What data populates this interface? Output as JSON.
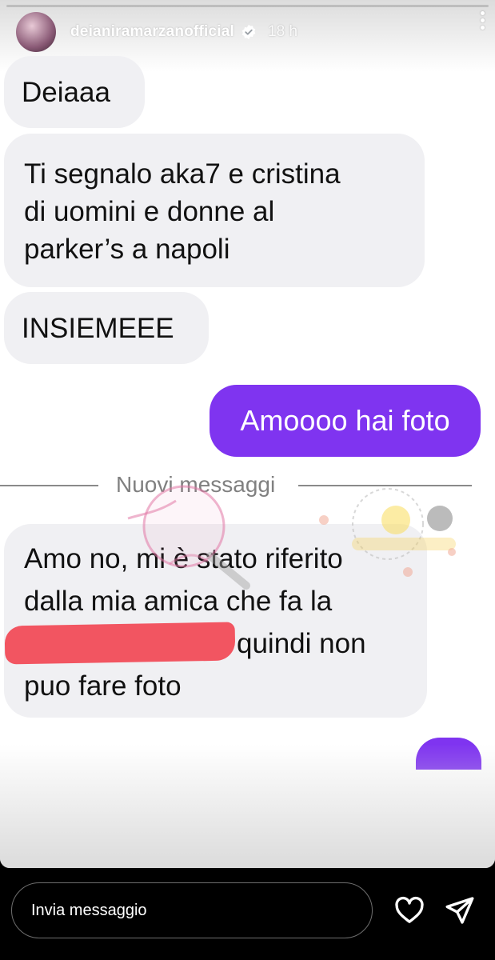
{
  "story": {
    "username": "deianiramarzanofficial",
    "time": "18 h",
    "verified": true
  },
  "chat": {
    "incoming_1": "Deiaaa",
    "incoming_2_lines": [
      "Ti segnalo aka7 e cristina",
      "di uomini e donne al",
      "parker’s a napoli"
    ],
    "incoming_3": "INSIEMEEE",
    "outgoing_1": "Amoooo hai foto",
    "separator": "Nuovi messaggi",
    "incoming_4_lines": [
      "Amo no, mi è stato riferito",
      "dalla mia amica che fa la",
      "quindi non",
      "puo fare foto"
    ]
  },
  "footer": {
    "message_placeholder": "Invia messaggio"
  },
  "colors": {
    "outgoing_bubble": "#7f34f0",
    "incoming_bubble": "#f0f0f3",
    "redaction": "#f25561"
  },
  "icons": [
    "verified-badge-icon",
    "more-options-icon",
    "heart-icon",
    "share-icon"
  ]
}
